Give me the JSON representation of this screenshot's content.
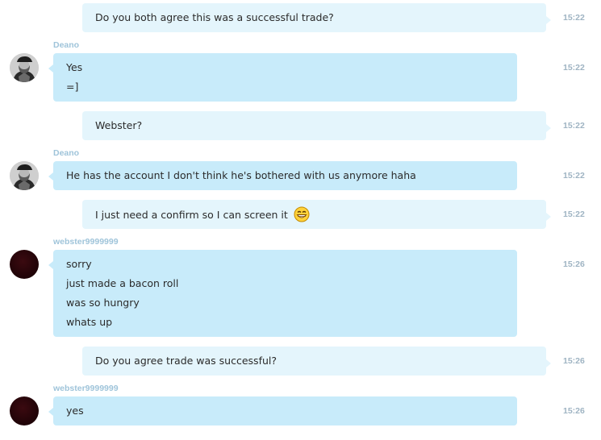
{
  "messages": [
    {
      "text": "Do you both agree this was a successful trade?",
      "time": "15:22"
    },
    {
      "sender": "Deano",
      "lines": [
        "Yes",
        "=]"
      ],
      "time": "15:22"
    },
    {
      "text": "Webster?",
      "time": "15:22"
    },
    {
      "sender": "Deano",
      "lines": [
        "He has the account I don't think he's bothered with us anymore haha"
      ],
      "time": "15:22"
    },
    {
      "text": "I just need a confirm so I can screen it",
      "emoticon": "grin-smiley-icon",
      "time": "15:22"
    },
    {
      "sender": "webster9999999",
      "lines": [
        "sorry",
        "just made a bacon roll",
        "was so hungry",
        "whats up"
      ],
      "time": "15:26"
    },
    {
      "text": "Do you agree trade was successful?",
      "time": "15:26"
    },
    {
      "sender": "webster9999999",
      "lines": [
        "yes"
      ],
      "time": "15:26"
    }
  ]
}
